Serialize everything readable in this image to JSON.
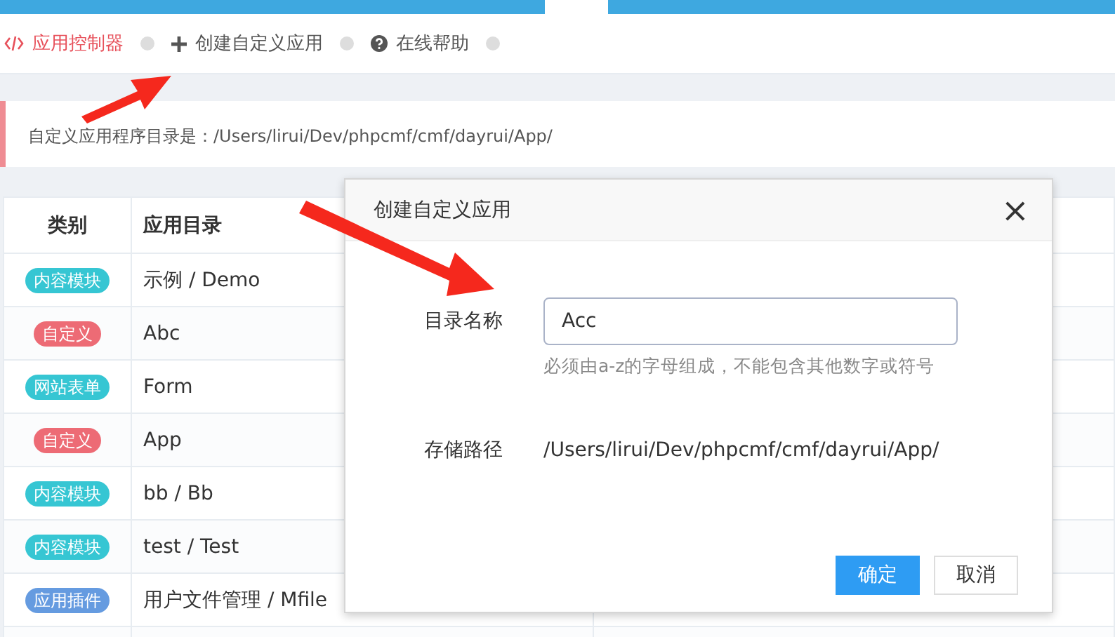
{
  "breadcrumb": [
    {
      "label": "应用控制器",
      "selected": true
    },
    {
      "label": "创建自定义应用",
      "selected": false
    },
    {
      "label": "在线帮助",
      "selected": false
    }
  ],
  "notice": {
    "text": "自定义应用程序目录是：/Users/lirui/Dev/phpcmf/cmf/dayrui/App/"
  },
  "table": {
    "columns": [
      "类别",
      "应用目录"
    ],
    "rows": [
      {
        "type": "内容模块",
        "color": "#36c6d3",
        "dir": "示例 / Demo"
      },
      {
        "type": "自定义",
        "color": "#ed6b75",
        "dir": "Abc"
      },
      {
        "type": "网站表单",
        "color": "#36c6d3",
        "dir": "Form"
      },
      {
        "type": "自定义",
        "color": "#ed6b75",
        "dir": "App"
      },
      {
        "type": "内容模块",
        "color": "#36c6d3",
        "dir": "bb / Bb"
      },
      {
        "type": "内容模块",
        "color": "#36c6d3",
        "dir": "test / Test"
      },
      {
        "type": "应用插件",
        "color": "#659be0",
        "dir": "用户文件管理 / Mfile"
      }
    ]
  },
  "dialog": {
    "title": "创建自定义应用",
    "close": "×",
    "fields": [
      {
        "kind": "input",
        "label": "目录名称",
        "value": "Acc",
        "help": "必须由a-z的字母组成，不能包含其他数字或符号"
      },
      {
        "kind": "text",
        "label": "存储路径",
        "value": "/Users/lirui/Dev/phpcmf/cmf/dayrui/App/"
      }
    ],
    "buttons": [
      {
        "label": "确定",
        "primary": true
      },
      {
        "label": "取消",
        "primary": false
      }
    ]
  }
}
